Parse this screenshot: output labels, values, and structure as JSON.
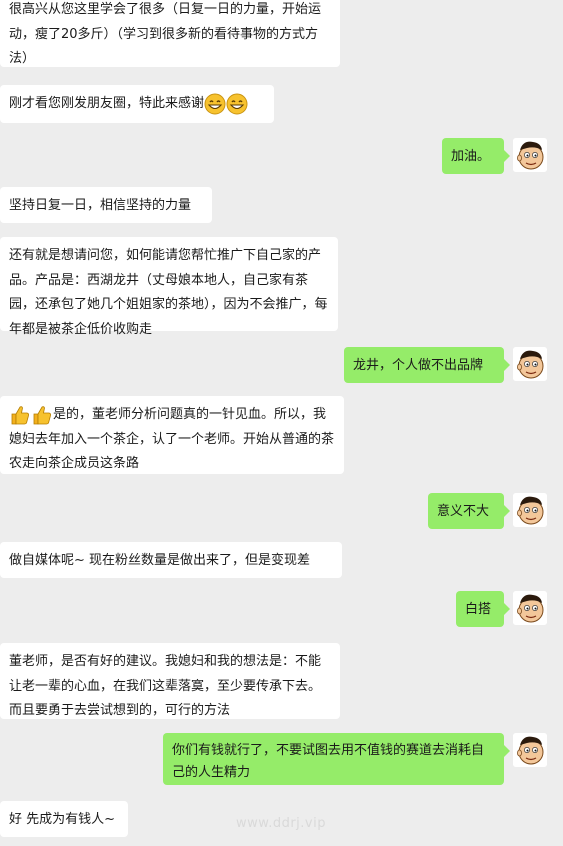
{
  "chat": {
    "messages": [
      {
        "side": "in",
        "text": "很高兴从您这里学会了很多（日复一日的力量，开始运动，瘦了20多斤）（学习到很多新的看待事物的方式方法）"
      },
      {
        "side": "in",
        "text": "刚才看您刚发朋友圈，特此来感谢",
        "emoji_after": [
          "grin-emoji",
          "grin-emoji"
        ]
      },
      {
        "side": "out",
        "text": "加油。"
      },
      {
        "side": "in",
        "text": "坚持日复一日，相信坚持的力量"
      },
      {
        "side": "in",
        "text": "还有就是想请问您，如何能请您帮忙推广下自己家的产品。产品是：西湖龙井（丈母娘本地人，自己家有茶园，还承包了她几个姐姐家的茶地），因为不会推广，每年都是被茶企低价收购走"
      },
      {
        "side": "out",
        "text": "龙井，个人做不出品牌"
      },
      {
        "side": "in",
        "text": "是的，董老师分析问题真的一针见血。所以，我媳妇去年加入一个茶企，认了一个老师。开始从普通的茶农走向茶企成员这条路",
        "emoji_before": [
          "thumbs-up-emoji",
          "thumbs-up-emoji"
        ]
      },
      {
        "side": "out",
        "text": "意义不大"
      },
      {
        "side": "in",
        "text": "做自媒体呢~ 现在粉丝数量是做出来了，但是变现差"
      },
      {
        "side": "out",
        "text": "白搭"
      },
      {
        "side": "in",
        "text": "董老师，是否有好的建议。我媳妇和我的想法是：不能让老一辈的心血，在我们这辈落寞，至少要传承下去。而且要勇于去尝试想到的，可行的方法"
      },
      {
        "side": "out",
        "text": "你们有钱就行了，不要试图去用不值钱的赛道去消耗自己的人生精力"
      },
      {
        "side": "in",
        "text": "好 先成为有钱人~"
      }
    ]
  },
  "watermark": "www.ddrj.vip",
  "colors": {
    "background": "#ededed",
    "incoming_bubble": "#ffffff",
    "outgoing_bubble": "#95ec69"
  }
}
